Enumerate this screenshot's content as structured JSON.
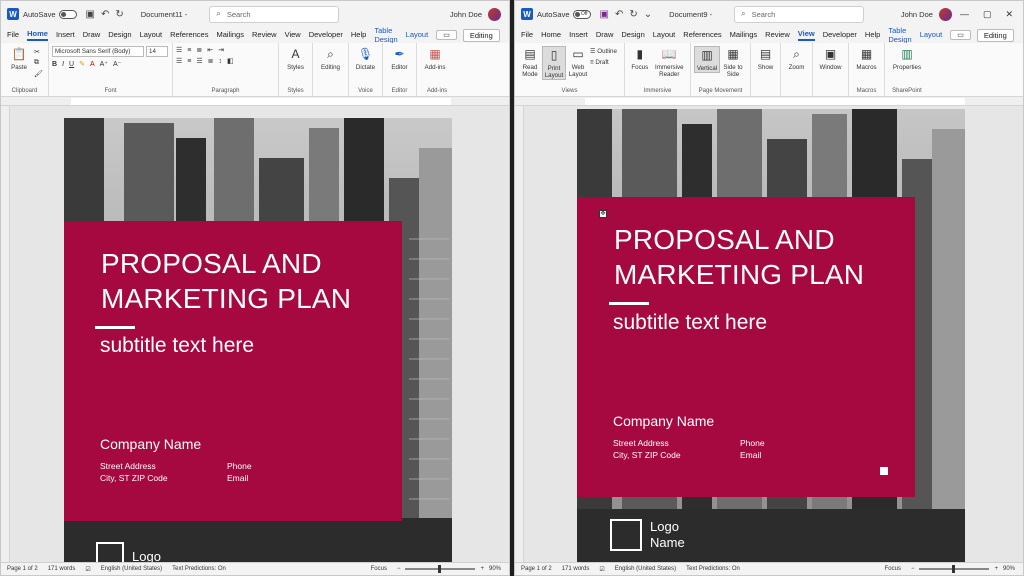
{
  "left_window": {
    "title": {
      "autosave": "AutoSave",
      "doc_name": "Document11 -",
      "search_placeholder": "Search",
      "user": "John Doe"
    },
    "tabs": [
      "File",
      "Home",
      "Insert",
      "Draw",
      "Design",
      "Layout",
      "References",
      "Mailings",
      "Review",
      "View",
      "Developer",
      "Help",
      "Table Design",
      "Layout"
    ],
    "active_tab": "Home",
    "editing_label": "Editing",
    "ribbon": {
      "clipboard": {
        "paste": "Paste",
        "label": "Clipboard"
      },
      "font": {
        "name": "Microsoft Sans Serif (Body)",
        "size": "14",
        "label": "Font"
      },
      "paragraph": {
        "label": "Paragraph"
      },
      "styles": {
        "btn": "Styles",
        "label": "Styles"
      },
      "editing": {
        "btn": "Editing"
      },
      "voice": {
        "btn": "Dictate",
        "label": "Voice"
      },
      "editor": {
        "btn": "Editor",
        "label": "Editor"
      },
      "addins": {
        "btn": "Add-ins",
        "label": "Add-ins"
      }
    },
    "document": {
      "title": "PROPOSAL AND\nMARKETING PLAN",
      "subtitle": "subtitle text here",
      "company": "Company Name",
      "street": "Street Address",
      "city": "City, ST ZIP Code",
      "phone": "Phone",
      "email": "Email",
      "logo": "Logo"
    },
    "status": {
      "page": "Page 1 of 2",
      "words": "171 words",
      "language": "English (United States)",
      "predictions": "Text Predictions: On",
      "focus": "Focus",
      "zoom": "90%"
    }
  },
  "right_window": {
    "title": {
      "autosave": "AutoSave",
      "toggle": "Off",
      "doc_name": "Document9 -",
      "search_placeholder": "Search",
      "user": "John Doe"
    },
    "tabs": [
      "File",
      "Home",
      "Insert",
      "Draw",
      "Design",
      "Layout",
      "References",
      "Mailings",
      "Review",
      "View",
      "Developer",
      "Help",
      "Table Design",
      "Layout"
    ],
    "active_tab": "View",
    "editing_label": "Editing",
    "ribbon": {
      "views": {
        "read": "Read Mode",
        "print": "Print Layout",
        "web": "Web Layout",
        "outline": "Outline",
        "draft": "Draft",
        "label": "Views"
      },
      "immersive": {
        "focus": "Focus",
        "reader": "Immersive Reader",
        "label": "Immersive"
      },
      "movement": {
        "vertical": "Vertical",
        "side": "Side to Side",
        "label": "Page Movement"
      },
      "show": {
        "btn": "Show"
      },
      "zoom": {
        "btn": "Zoom"
      },
      "window": {
        "btn": "Window"
      },
      "macros": {
        "btn": "Macros",
        "label": "Macros"
      },
      "sharepoint": {
        "btn": "Properties",
        "label": "SharePoint"
      }
    },
    "document": {
      "title": "PROPOSAL AND\nMARKETING PLAN",
      "subtitle": "subtitle text here",
      "company": "Company Name",
      "street": "Street Address",
      "city": "City, ST ZIP Code",
      "phone": "Phone",
      "email": "Email",
      "logo": "Logo\nName"
    },
    "status": {
      "page": "Page 1 of 2",
      "words": "171 words",
      "language": "English (United States)",
      "predictions": "Text Predictions: On",
      "focus": "Focus",
      "zoom": "90%"
    }
  },
  "colors": {
    "accent_red": "#a5093f",
    "word_blue": "#185abd"
  }
}
